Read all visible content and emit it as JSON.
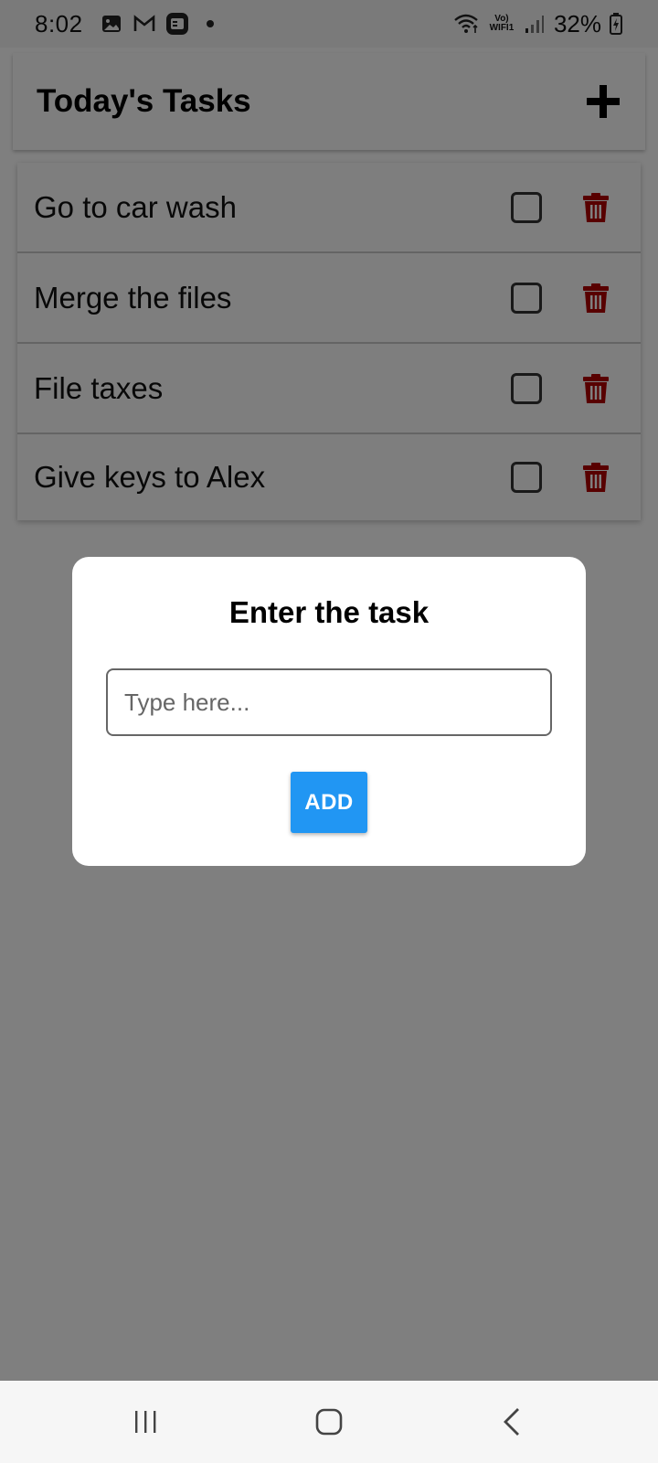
{
  "status_bar": {
    "time": "8:02",
    "network_label": "Vo) WIFI1",
    "battery": "32%",
    "icons": [
      "gallery-icon",
      "gmail-icon",
      "app-notification-icon",
      "dot-icon",
      "wifi-icon",
      "signal-icon",
      "battery-charging-icon"
    ]
  },
  "header": {
    "title": "Today's Tasks",
    "add_icon": "plus-icon"
  },
  "tasks": [
    {
      "label": "Go to car wash",
      "checked": false
    },
    {
      "label": "Merge the files",
      "checked": false
    },
    {
      "label": "File taxes",
      "checked": false
    },
    {
      "label": "Give keys to Alex",
      "checked": false
    }
  ],
  "dialog": {
    "title": "Enter the task",
    "input_placeholder": "Type here...",
    "input_value": "",
    "add_button_label": "ADD"
  },
  "colors": {
    "add_button": "#2196f3",
    "trash": "#b00000",
    "overlay": "rgba(0,0,0,0.5)"
  },
  "nav_bar": {
    "icons": [
      "recent-apps-icon",
      "home-icon",
      "back-icon"
    ]
  }
}
